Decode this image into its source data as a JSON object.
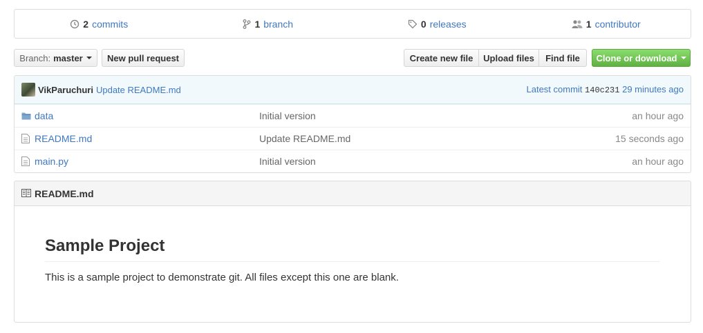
{
  "summary": {
    "commits": {
      "count": "2",
      "label": "commits"
    },
    "branches": {
      "count": "1",
      "label": "branch"
    },
    "releases": {
      "count": "0",
      "label": "releases"
    },
    "contributors": {
      "count": "1",
      "label": "contributor"
    }
  },
  "toolbar": {
    "branch_prefix": "Branch:",
    "branch_name": "master",
    "new_pull_request": "New pull request",
    "create_new_file": "Create new file",
    "upload_files": "Upload files",
    "find_file": "Find file",
    "clone_or_download": "Clone or download"
  },
  "commit_bar": {
    "author": "VikParuchuri",
    "message": "Update README.md",
    "latest_label": "Latest commit",
    "sha": "140c231",
    "time": "29 minutes ago"
  },
  "files": [
    {
      "icon": "folder-icon",
      "name": "data",
      "message": "Initial version",
      "age": "an hour ago"
    },
    {
      "icon": "file-icon",
      "name": "README.md",
      "message": "Update README.md",
      "age": "15 seconds ago"
    },
    {
      "icon": "file-icon",
      "name": "main.py",
      "message": "Initial version",
      "age": "an hour ago"
    }
  ],
  "readme": {
    "filename": "README.md",
    "heading": "Sample Project",
    "paragraph": "This is a sample project to demonstrate git. All files except this one are blank."
  },
  "colors": {
    "link": "#4078c0",
    "green_button": "#6cc644",
    "commit_bar_bg": "#f2f9fc"
  }
}
